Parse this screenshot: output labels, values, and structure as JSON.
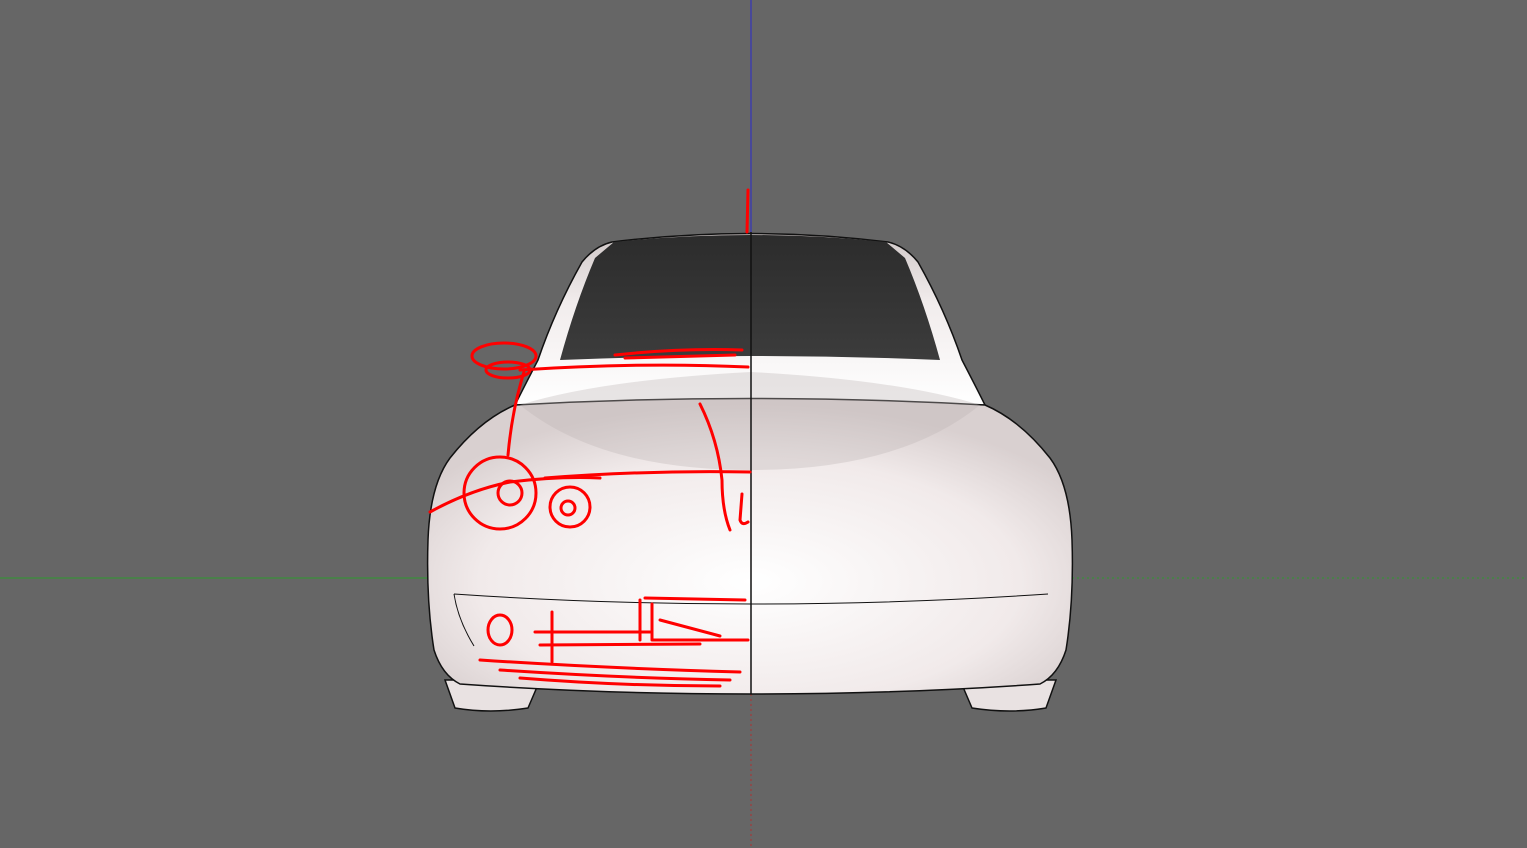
{
  "viewport": {
    "background_color": "#666666",
    "axis_colors": {
      "blue_axis": "#2a2acc",
      "green_axis": "#2f9a2f",
      "red_axis": "#b03030"
    },
    "model": {
      "body_color": "#f4eeee",
      "shadow_color": "#d8d0d0",
      "windshield_color": "#333333",
      "edge_color": "#111111"
    },
    "sketch": {
      "stroke_color": "#ff0000"
    }
  }
}
